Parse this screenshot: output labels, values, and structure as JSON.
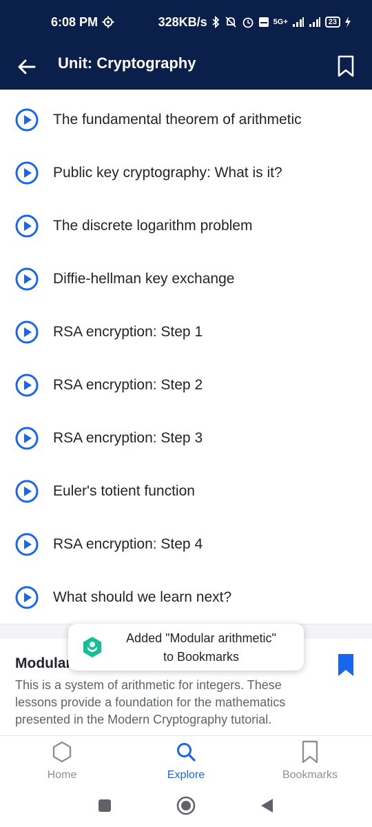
{
  "status_bar": {
    "time": "6:08 PM",
    "speed": "328KB/s",
    "network": "5G+",
    "battery": "23"
  },
  "app_bar": {
    "title": "Unit: Cryptography"
  },
  "lessons": [
    {
      "title": "The fundamental theorem of arithmetic"
    },
    {
      "title": "Public key cryptography: What is it?"
    },
    {
      "title": "The discrete logarithm problem"
    },
    {
      "title": "Diffie-hellman key exchange"
    },
    {
      "title": "RSA encryption: Step 1"
    },
    {
      "title": "RSA encryption: Step 2"
    },
    {
      "title": "RSA encryption: Step 3"
    },
    {
      "title": "Euler's totient function"
    },
    {
      "title": "RSA encryption: Step 4"
    },
    {
      "title": "What should we learn next?"
    }
  ],
  "next_unit": {
    "title": "Modular arithmetic",
    "description": "This is a system of arithmetic for integers. These lessons provide a foundation for the mathematics presented in the Modern Cryptography tutorial."
  },
  "toast": {
    "line1": "Added \"Modular arithmetic\"",
    "line2": "to Bookmarks"
  },
  "bottom_nav": {
    "home": "Home",
    "explore": "Explore",
    "bookmarks": "Bookmarks"
  },
  "colors": {
    "header_bg": "#0a1f4a",
    "accent": "#1865f2",
    "text": "#21242c",
    "muted": "#8c8f94"
  },
  "icons": {
    "lesson": "play-circle-icon",
    "back": "arrow-left-icon",
    "bookmark": "bookmark-icon"
  }
}
